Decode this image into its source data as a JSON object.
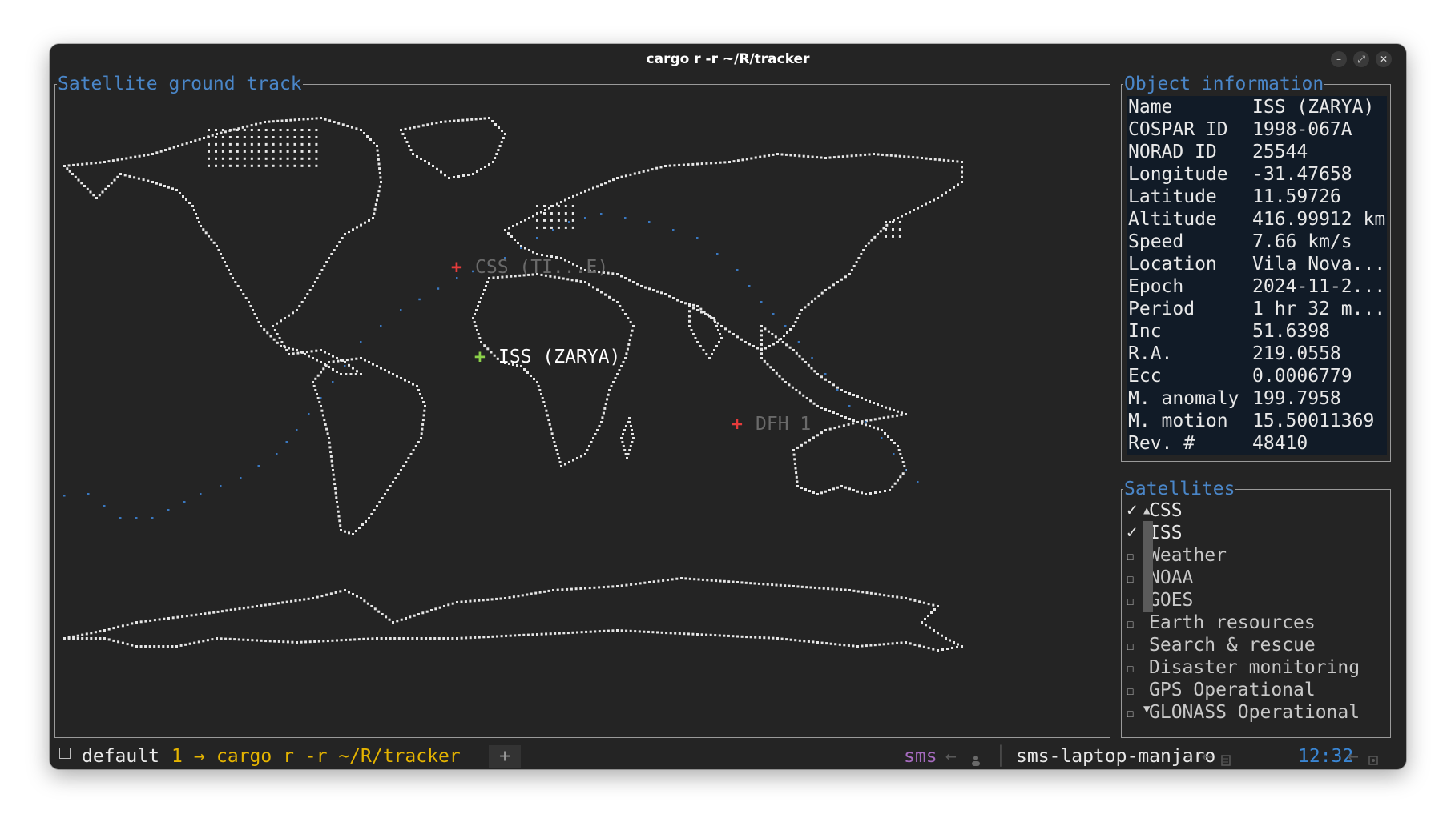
{
  "window": {
    "title": "cargo r -r ~/R/tracker",
    "minimize": "–",
    "maximize": "⤢",
    "close": "✕"
  },
  "map_panel": {
    "title": "Satellite ground track"
  },
  "map_labels": [
    {
      "name": "CSS (TI...E)",
      "marker": "+",
      "marker_color": "#e53b3b",
      "label_color": "#6a6a6a"
    },
    {
      "name": "ISS (ZARYA)",
      "marker": "+",
      "marker_color": "#8bd04a",
      "label_color": "#ffffff"
    },
    {
      "name": "DFH 1",
      "marker": "+",
      "marker_color": "#e53b3b",
      "label_color": "#6a6a6a"
    }
  ],
  "info_panel": {
    "title": "Object information",
    "rows": [
      {
        "key": "Name",
        "value": "ISS (ZARYA)"
      },
      {
        "key": "COSPAR ID",
        "value": "1998-067A"
      },
      {
        "key": "NORAD ID",
        "value": "25544"
      },
      {
        "key": "Longitude",
        "value": " -31.47658"
      },
      {
        "key": "Latitude",
        "value": "  11.59726"
      },
      {
        "key": "Altitude",
        "value": "416.99912 km"
      },
      {
        "key": "Speed",
        "value": "7.66 km/s"
      },
      {
        "key": "Location",
        "value": "Vila Nova..."
      },
      {
        "key": "Epoch",
        "value": "2024-11-2..."
      },
      {
        "key": "Period",
        "value": "1 hr 32 m..."
      },
      {
        "key": "Inc",
        "value": "51.6398"
      },
      {
        "key": "R.A.",
        "value": "219.0558"
      },
      {
        "key": "Ecc",
        "value": "0.0006779"
      },
      {
        "key": "M. anomaly",
        "value": "199.7958"
      },
      {
        "key": "M. motion",
        "value": "15.50011369"
      },
      {
        "key": "Rev. #",
        "value": "48410"
      }
    ]
  },
  "satellites_panel": {
    "title": "Satellites",
    "items": [
      {
        "label": "CSS",
        "checked": true
      },
      {
        "label": "ISS",
        "checked": true
      },
      {
        "label": "Weather",
        "checked": false
      },
      {
        "label": "NOAA",
        "checked": false
      },
      {
        "label": "GOES",
        "checked": false
      },
      {
        "label": "Earth resources",
        "checked": false
      },
      {
        "label": "Search & rescue",
        "checked": false
      },
      {
        "label": "Disaster monitoring",
        "checked": false
      },
      {
        "label": "GPS Operational",
        "checked": false
      },
      {
        "label": "GLONASS Operational",
        "checked": false
      }
    ],
    "checked_glyph": "✓",
    "unchecked_glyph": "☐",
    "scroll_up": "▲",
    "scroll_down": "▼"
  },
  "statusbar": {
    "session": "default",
    "window_index": "1",
    "arrow": "→",
    "command": "cargo r -r ~/R/tracker",
    "new_tab": "+",
    "user": "sms",
    "host": "sms-laptop-manjaro",
    "time": "12:32",
    "sep": "←",
    "colors": {
      "yellow": "#e5b400",
      "purple": "#a66bbf",
      "blue": "#3a86d4"
    }
  },
  "map_colors": {
    "land": "#e6e6e6",
    "track": "#3a78c0"
  }
}
